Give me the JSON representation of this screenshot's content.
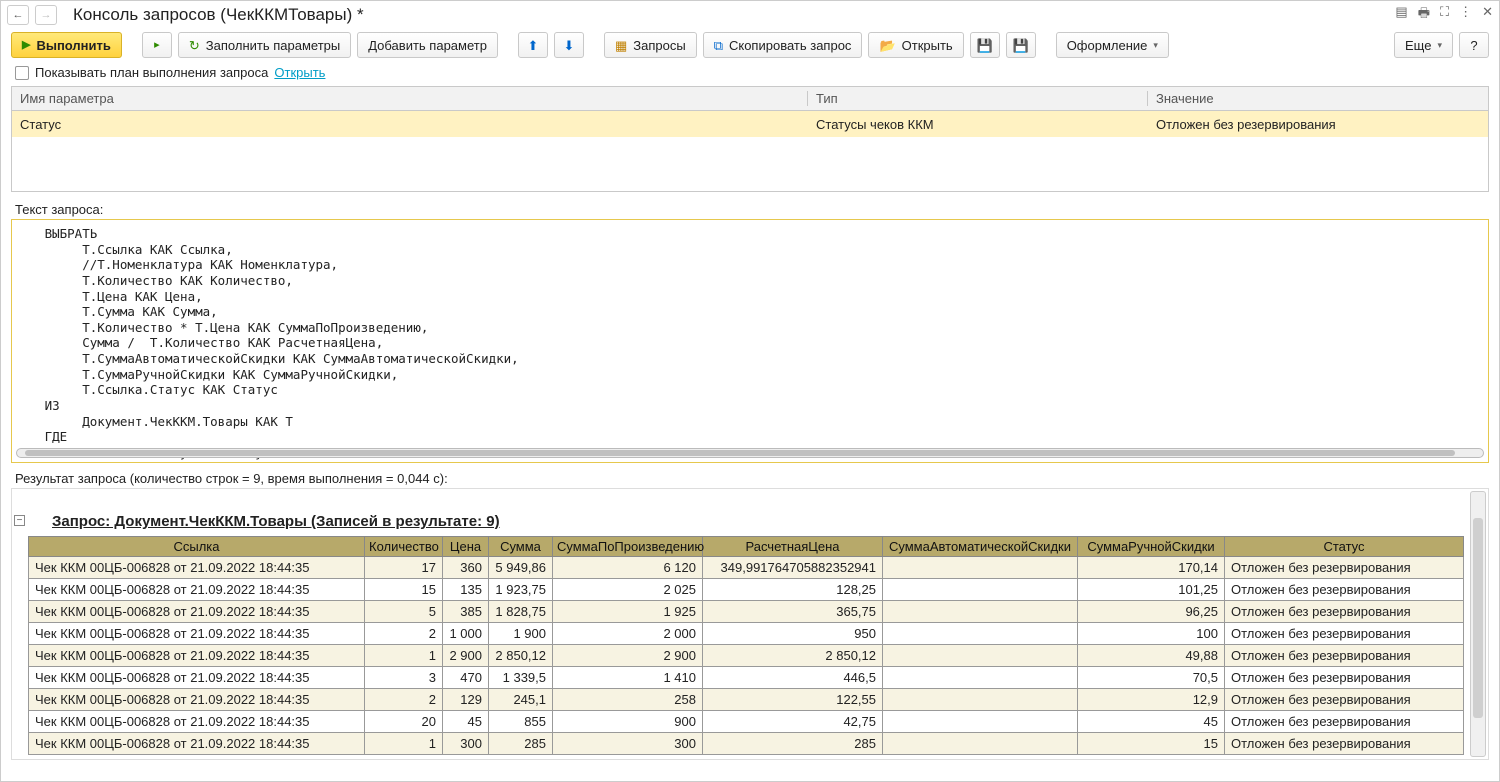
{
  "window_title": "Консоль запросов (ЧекККМТовары) *",
  "toolbar": {
    "run": "Выполнить",
    "fill_params": "Заполнить параметры",
    "add_param": "Добавить параметр",
    "queries": "Запросы",
    "copy_query": "Скопировать запрос",
    "open": "Открыть",
    "design": "Оформление",
    "more": "Еще",
    "help": "?"
  },
  "plan_row": {
    "checkbox_label": "Показывать план выполнения запроса",
    "open_link": "Открыть"
  },
  "params_table": {
    "headers": {
      "name": "Имя параметра",
      "type": "Тип",
      "value": "Значение"
    },
    "row": {
      "name": "Статус",
      "type": "Статусы чеков ККМ",
      "value": "Отложен без резервирования"
    }
  },
  "query_label": "Текст запроса:",
  "query_text": "   ВЫБРАТЬ\n        Т.Ссылка КАК Ссылка,\n        //Т.Номенклатура КАК Номенклатура,\n        Т.Количество КАК Количество,\n        Т.Цена КАК Цена,\n        Т.Сумма КАК Сумма,\n        Т.Количество * Т.Цена КАК СуммаПоПроизведению,\n        Сумма /  Т.Количество КАК РасчетнаяЦена,\n        Т.СуммаАвтоматическойСкидки КАК СуммаАвтоматическойСкидки,\n        Т.СуммаРучнойСкидки КАК СуммаРучнойСкидки,\n        Т.Ссылка.Статус КАК Статус\n   ИЗ\n        Документ.ЧекККМ.Товары КАК Т\n   ГДЕ\n        Т.Ссылка.Статус = &Статус\n        И Т.Количество * Т.Цена <> Т.Сумма",
  "result_label": "Результат запроса (количество строк = 9, время выполнения = 0,044 с):",
  "result_title": "Запрос: Документ.ЧекККМ.Товары (Записей в результате: 9)",
  "result_headers": [
    "Ссылка",
    "Количество",
    "Цена",
    "Сумма",
    "СуммаПоПроизведению",
    "РасчетнаяЦена",
    "СуммаАвтоматическойСкидки",
    "СуммаРучнойСкидки",
    "Статус"
  ],
  "rows": [
    {
      "link": "Чек ККМ 00ЦБ-006828 от 21.09.2022 18:44:35",
      "qty": "17",
      "price": "360",
      "sum": "5 949,86",
      "prod": "6 120",
      "calc": "349,991764705882352941",
      "auto": "",
      "man": "170,14",
      "status": "Отложен без резервирования"
    },
    {
      "link": "Чек ККМ 00ЦБ-006828 от 21.09.2022 18:44:35",
      "qty": "15",
      "price": "135",
      "sum": "1 923,75",
      "prod": "2 025",
      "calc": "128,25",
      "auto": "",
      "man": "101,25",
      "status": "Отложен без резервирования"
    },
    {
      "link": "Чек ККМ 00ЦБ-006828 от 21.09.2022 18:44:35",
      "qty": "5",
      "price": "385",
      "sum": "1 828,75",
      "prod": "1 925",
      "calc": "365,75",
      "auto": "",
      "man": "96,25",
      "status": "Отложен без резервирования"
    },
    {
      "link": "Чек ККМ 00ЦБ-006828 от 21.09.2022 18:44:35",
      "qty": "2",
      "price": "1 000",
      "sum": "1 900",
      "prod": "2 000",
      "calc": "950",
      "auto": "",
      "man": "100",
      "status": "Отложен без резервирования"
    },
    {
      "link": "Чек ККМ 00ЦБ-006828 от 21.09.2022 18:44:35",
      "qty": "1",
      "price": "2 900",
      "sum": "2 850,12",
      "prod": "2 900",
      "calc": "2 850,12",
      "auto": "",
      "man": "49,88",
      "status": "Отложен без резервирования"
    },
    {
      "link": "Чек ККМ 00ЦБ-006828 от 21.09.2022 18:44:35",
      "qty": "3",
      "price": "470",
      "sum": "1 339,5",
      "prod": "1 410",
      "calc": "446,5",
      "auto": "",
      "man": "70,5",
      "status": "Отложен без резервирования"
    },
    {
      "link": "Чек ККМ 00ЦБ-006828 от 21.09.2022 18:44:35",
      "qty": "2",
      "price": "129",
      "sum": "245,1",
      "prod": "258",
      "calc": "122,55",
      "auto": "",
      "man": "12,9",
      "status": "Отложен без резервирования"
    },
    {
      "link": "Чек ККМ 00ЦБ-006828 от 21.09.2022 18:44:35",
      "qty": "20",
      "price": "45",
      "sum": "855",
      "prod": "900",
      "calc": "42,75",
      "auto": "",
      "man": "45",
      "status": "Отложен без резервирования"
    },
    {
      "link": "Чек ККМ 00ЦБ-006828 от 21.09.2022 18:44:35",
      "qty": "1",
      "price": "300",
      "sum": "285",
      "prod": "300",
      "calc": "285",
      "auto": "",
      "man": "15",
      "status": "Отложен без резервирования"
    }
  ]
}
